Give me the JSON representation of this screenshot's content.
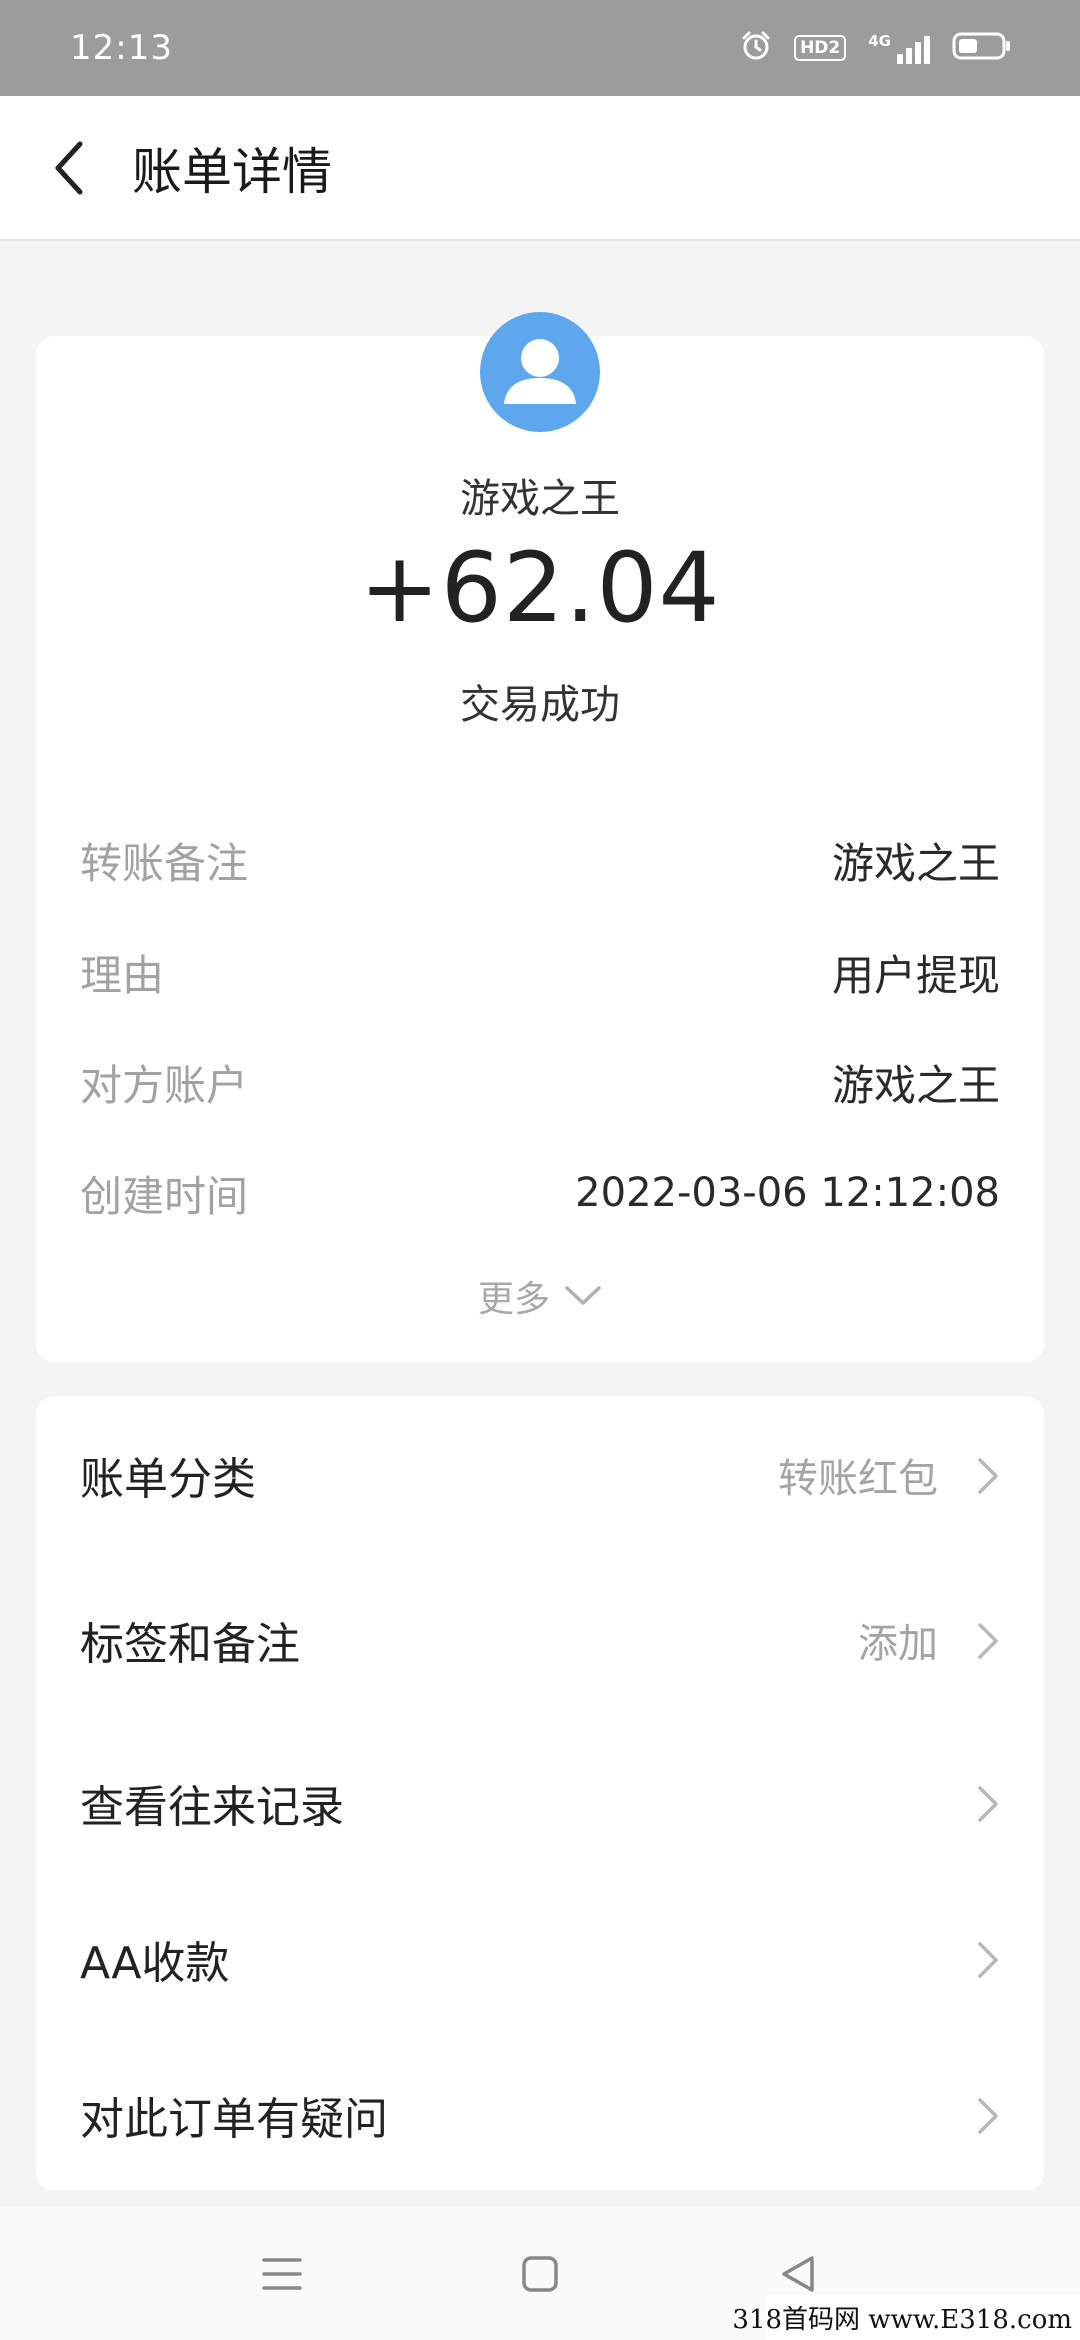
{
  "status_bar": {
    "time": "12:13",
    "hd_label": "HD2",
    "network_label": "4G",
    "icons": [
      "alarm-icon",
      "hd-icon",
      "signal-icon",
      "battery-icon"
    ]
  },
  "header": {
    "title": "账单详情",
    "back_icon": "chevron-left-icon"
  },
  "transaction": {
    "counterparty": "游戏之王",
    "amount": "+62.04",
    "status": "交易成功",
    "avatar_color": "#5ea7ec",
    "details": [
      {
        "label": "转账备注",
        "value": "游戏之王"
      },
      {
        "label": "理由",
        "value": "用户提现"
      },
      {
        "label": "对方账户",
        "value": "游戏之王"
      },
      {
        "label": "创建时间",
        "value": "2022-03-06 12:12:08"
      }
    ],
    "more_label": "更多"
  },
  "menu": [
    {
      "label": "账单分类",
      "value": "转账红包"
    },
    {
      "label": "标签和备注",
      "value": "添加"
    },
    {
      "label": "查看往来记录",
      "value": ""
    },
    {
      "label": "AA收款",
      "value": ""
    },
    {
      "label": "对此订单有疑问",
      "value": ""
    }
  ],
  "nav_bar": {
    "icons": [
      "menu-icon",
      "home-square-icon",
      "back-triangle-icon"
    ]
  },
  "watermark": "318首码网 www.E318.com"
}
